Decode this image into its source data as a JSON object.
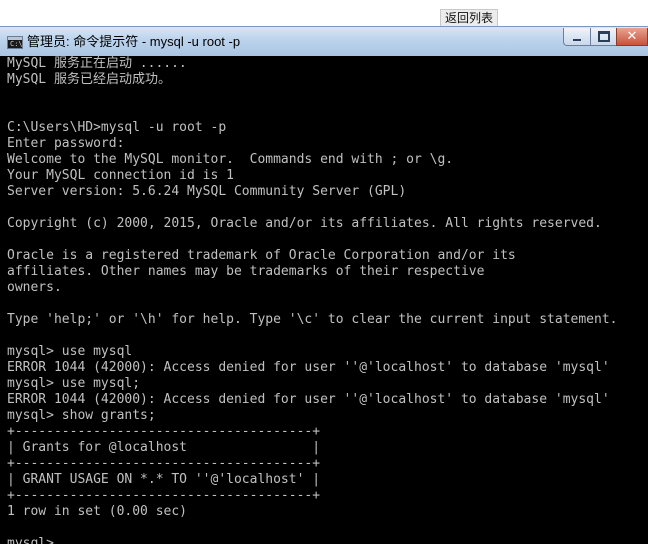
{
  "top": {
    "back_button": "返回列表"
  },
  "window": {
    "title": "管理员: 命令提示符 - mysql  -u root -p",
    "icon": "cmd-prompt-icon",
    "controls": {
      "minimize": "minimize-icon",
      "maximize": "maximize-icon",
      "close": "✕"
    }
  },
  "console": {
    "lines": [
      "MySQL 服务正在启动 ......",
      "MySQL 服务已经启动成功。",
      "",
      "",
      "C:\\Users\\HD>mysql -u root -p",
      "Enter password:",
      "Welcome to the MySQL monitor.  Commands end with ; or \\g.",
      "Your MySQL connection id is 1",
      "Server version: 5.6.24 MySQL Community Server (GPL)",
      "",
      "Copyright (c) 2000, 2015, Oracle and/or its affiliates. All rights reserved.",
      "",
      "Oracle is a registered trademark of Oracle Corporation and/or its",
      "affiliates. Other names may be trademarks of their respective",
      "owners.",
      "",
      "Type 'help;' or '\\h' for help. Type '\\c' to clear the current input statement.",
      "",
      "mysql> use mysql",
      "ERROR 1044 (42000): Access denied for user ''@'localhost' to database 'mysql'",
      "mysql> use mysql;",
      "ERROR 1044 (42000): Access denied for user ''@'localhost' to database 'mysql'",
      "mysql> show grants;",
      "+--------------------------------------+",
      "| Grants for @localhost                |",
      "+--------------------------------------+",
      "| GRANT USAGE ON *.* TO ''@'localhost' |",
      "+--------------------------------------+",
      "1 row in set (0.00 sec)",
      "",
      "mysql>"
    ]
  }
}
